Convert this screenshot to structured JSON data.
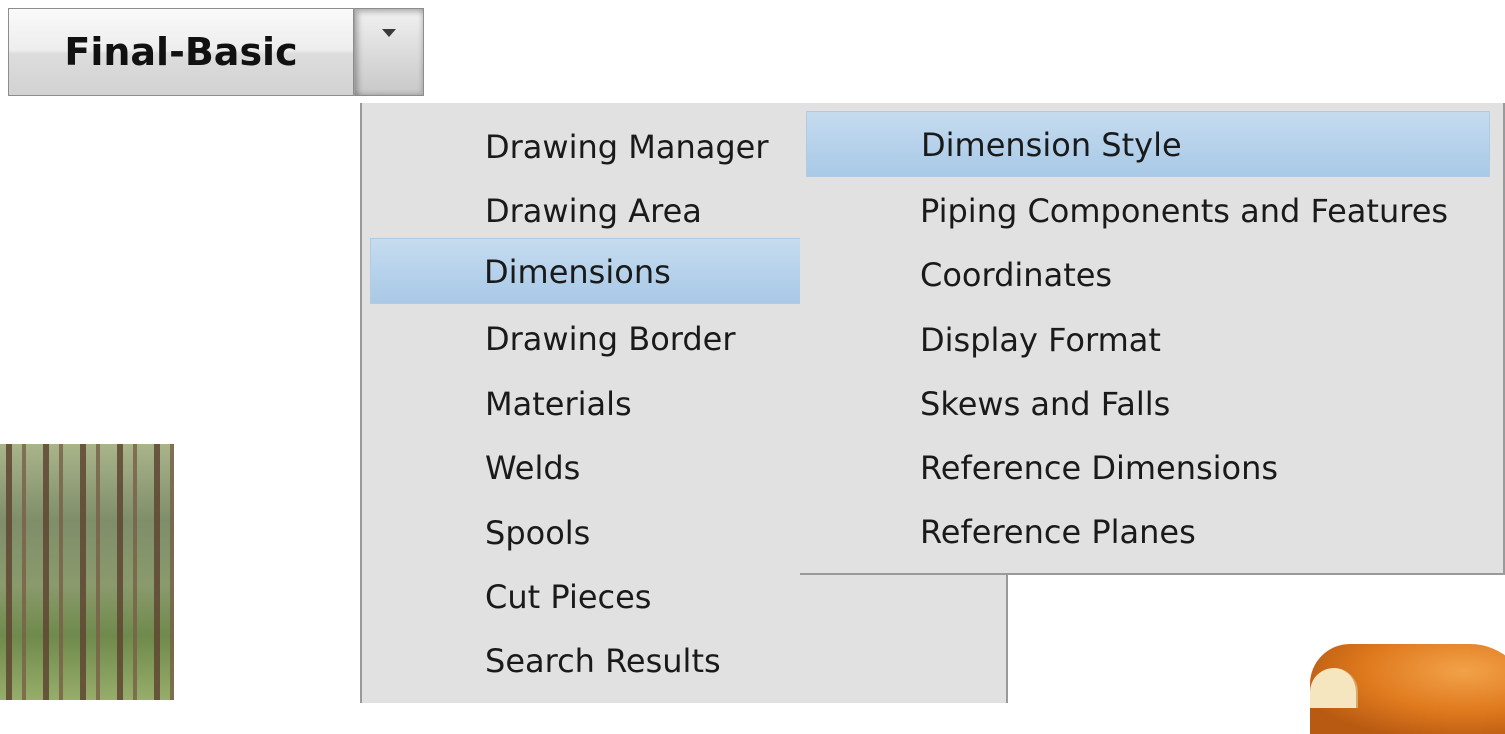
{
  "toolbar": {
    "combo_label": "Final-Basic"
  },
  "primary_menu": {
    "items": [
      {
        "label": "Drawing Manager"
      },
      {
        "label": "Drawing Area"
      },
      {
        "label": "Dimensions",
        "highlighted": true
      },
      {
        "label": "Drawing Border"
      },
      {
        "label": "Materials"
      },
      {
        "label": "Welds"
      },
      {
        "label": "Spools"
      },
      {
        "label": "Cut Pieces"
      },
      {
        "label": "Search Results"
      }
    ]
  },
  "submenu": {
    "items": [
      {
        "label": "Dimension Style",
        "highlighted": true
      },
      {
        "label": "Piping Components and Features"
      },
      {
        "label": "Coordinates"
      },
      {
        "label": "Display Format"
      },
      {
        "label": "Skews and Falls"
      },
      {
        "label": "Reference Dimensions"
      },
      {
        "label": "Reference Planes"
      }
    ]
  },
  "icons": {
    "dropdown_arrow": "chevron-down-icon"
  },
  "colors": {
    "menu_background": "#e1e1e1",
    "highlight": "#b8d3ec",
    "menu_border": "#9a9a9a"
  }
}
